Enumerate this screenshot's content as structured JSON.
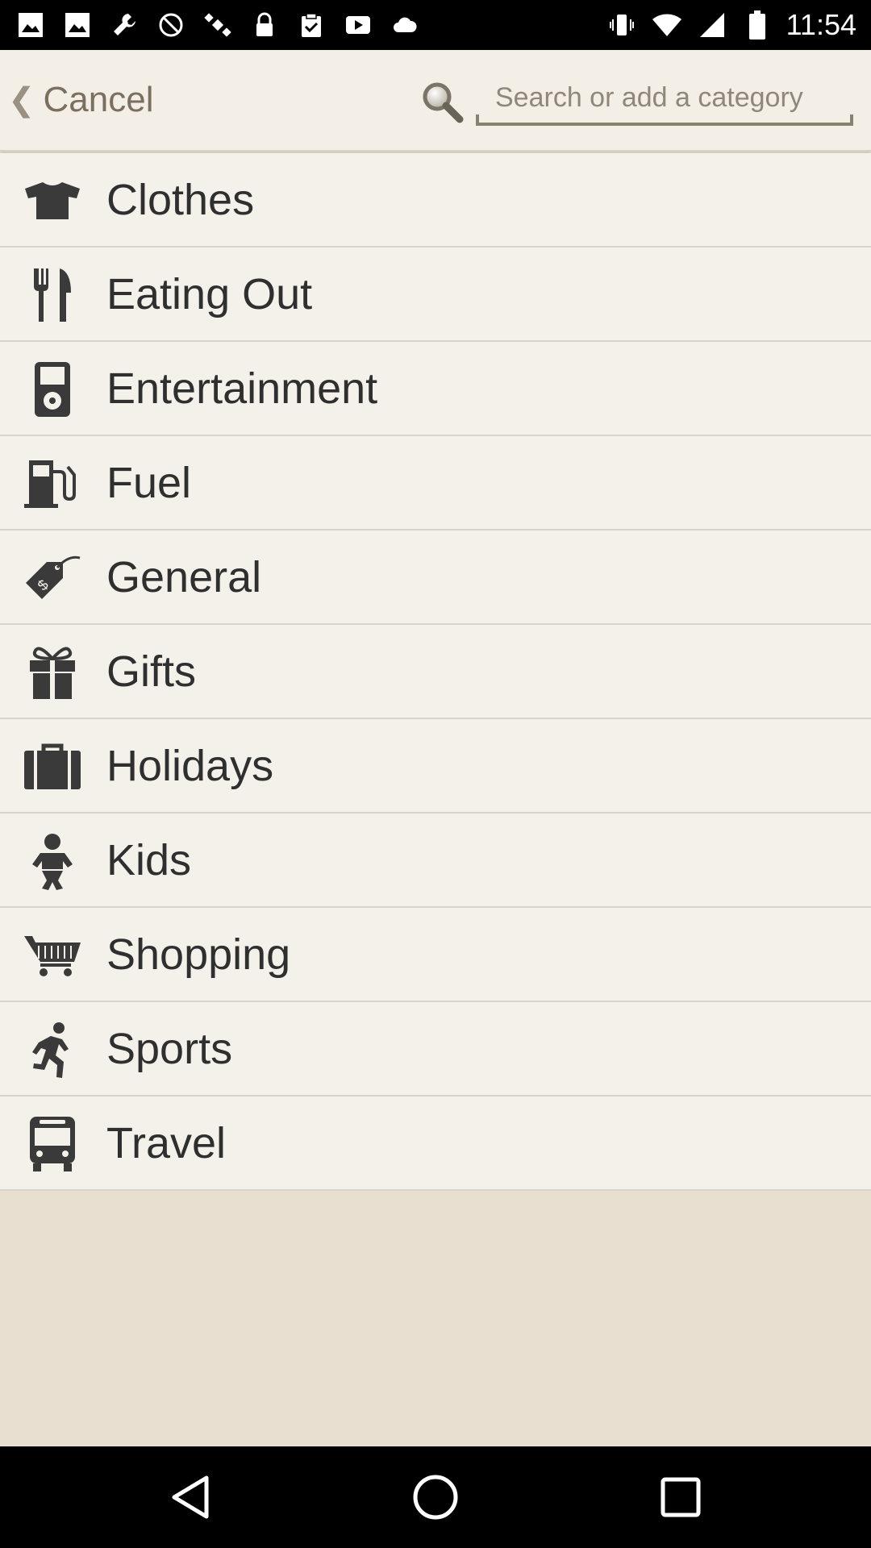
{
  "status_bar": {
    "time": "11:54",
    "left_icons": [
      "photo-icon",
      "photo-icon",
      "wrench-icon",
      "no-sync-icon",
      "satellite-icon",
      "lock-icon",
      "clipboard-icon",
      "play-icon",
      "cloud-icon"
    ],
    "right_icons": [
      "vibrate-icon",
      "wifi-icon",
      "signal-icon",
      "battery-icon"
    ]
  },
  "header": {
    "cancel_label": "Cancel",
    "search_placeholder": "Search or add a category"
  },
  "categories": [
    {
      "label": "Clothes",
      "icon": "tshirt-icon"
    },
    {
      "label": "Eating Out",
      "icon": "cutlery-icon"
    },
    {
      "label": "Entertainment",
      "icon": "music-player-icon"
    },
    {
      "label": "Fuel",
      "icon": "fuel-pump-icon"
    },
    {
      "label": "General",
      "icon": "price-tag-icon"
    },
    {
      "label": "Gifts",
      "icon": "gift-icon"
    },
    {
      "label": "Holidays",
      "icon": "suitcase-icon"
    },
    {
      "label": "Kids",
      "icon": "baby-icon"
    },
    {
      "label": "Shopping",
      "icon": "shopping-cart-icon"
    },
    {
      "label": "Sports",
      "icon": "running-icon"
    },
    {
      "label": "Travel",
      "icon": "bus-icon"
    }
  ],
  "nav_bar": {
    "buttons": [
      "back-icon",
      "home-icon",
      "recents-icon"
    ]
  },
  "colors": {
    "list_background": "#f4f1ea",
    "app_background": "#e8dfd1",
    "header_text": "#7b6f60",
    "label_text": "#2f2f2f",
    "icon_fill": "#3a3a3a"
  }
}
